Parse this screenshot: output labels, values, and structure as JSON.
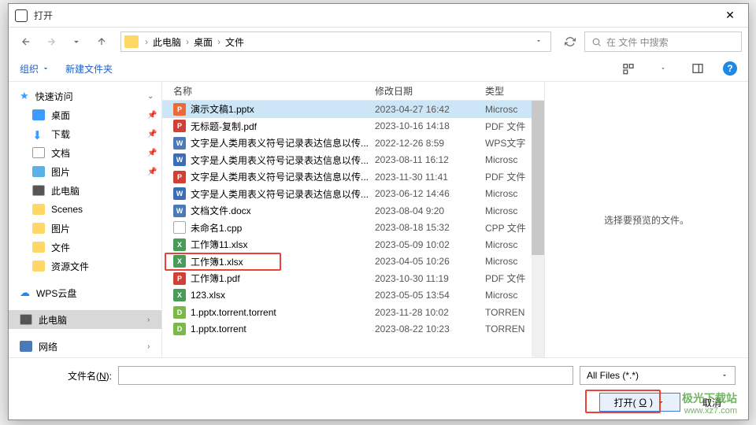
{
  "title": "打开",
  "breadcrumb": [
    "此电脑",
    "桌面",
    "文件"
  ],
  "search_placeholder": "在 文件 中搜索",
  "toolbar": {
    "organize": "组织",
    "newfolder": "新建文件夹"
  },
  "sidebar": {
    "quick": "快速访问",
    "items1": [
      "桌面",
      "下载",
      "文档",
      "图片",
      "此电脑",
      "Scenes",
      "图片",
      "文件",
      "资源文件"
    ],
    "wps": "WPS云盘",
    "thispc": "此电脑",
    "network": "网络"
  },
  "headers": {
    "name": "名称",
    "date": "修改日期",
    "type": "类型"
  },
  "files": [
    {
      "icon": "ppt",
      "name": "演示文稿1.pptx",
      "date": "2023-04-27 16:42",
      "type": "Microsc"
    },
    {
      "icon": "pdf",
      "name": "无标题-复制.pdf",
      "date": "2023-10-16 14:18",
      "type": "PDF 文件"
    },
    {
      "icon": "wps",
      "name": "文字是人类用表义符号记录表达信息以传...",
      "date": "2022-12-26 8:59",
      "type": "WPS文字"
    },
    {
      "icon": "word",
      "name": "文字是人类用表义符号记录表达信息以传...",
      "date": "2023-08-11 16:12",
      "type": "Microsc"
    },
    {
      "icon": "pdf",
      "name": "文字是人类用表义符号记录表达信息以传...",
      "date": "2023-11-30 11:41",
      "type": "PDF 文件"
    },
    {
      "icon": "word",
      "name": "文字是人类用表义符号记录表达信息以传...",
      "date": "2023-06-12 14:46",
      "type": "Microsc"
    },
    {
      "icon": "docx",
      "name": "文档文件.docx",
      "date": "2023-08-04 9:20",
      "type": "Microsc"
    },
    {
      "icon": "blank",
      "name": "未命名1.cpp",
      "date": "2023-08-18 15:32",
      "type": "CPP 文件"
    },
    {
      "icon": "xls",
      "name": "工作簿11.xlsx",
      "date": "2023-05-09 10:02",
      "type": "Microsc"
    },
    {
      "icon": "xls",
      "name": "工作簿1.xlsx",
      "date": "2023-04-05 10:26",
      "type": "Microsc"
    },
    {
      "icon": "pdf",
      "name": "工作簿1.pdf",
      "date": "2023-10-30 11:19",
      "type": "PDF 文件"
    },
    {
      "icon": "xls",
      "name": "123.xlsx",
      "date": "2023-05-05 13:54",
      "type": "Microsc"
    },
    {
      "icon": "torrent",
      "name": "1.pptx.torrent.torrent",
      "date": "2023-11-28 10:02",
      "type": "TORREN"
    },
    {
      "icon": "torrent",
      "name": "1.pptx.torrent",
      "date": "2023-08-22 10:23",
      "type": "TORREN"
    }
  ],
  "preview_msg": "选择要预览的文件。",
  "filename_label_pre": "文件名(",
  "filename_label_u": "N",
  "filename_label_post": "):",
  "filter": "All Files (*.*)",
  "open_btn_pre": "打开(",
  "open_btn_u": "O",
  "open_btn_post": ")",
  "cancel_btn": "取消",
  "watermark": {
    "brand": "极光下载站",
    "url": "www.xz7.com"
  }
}
